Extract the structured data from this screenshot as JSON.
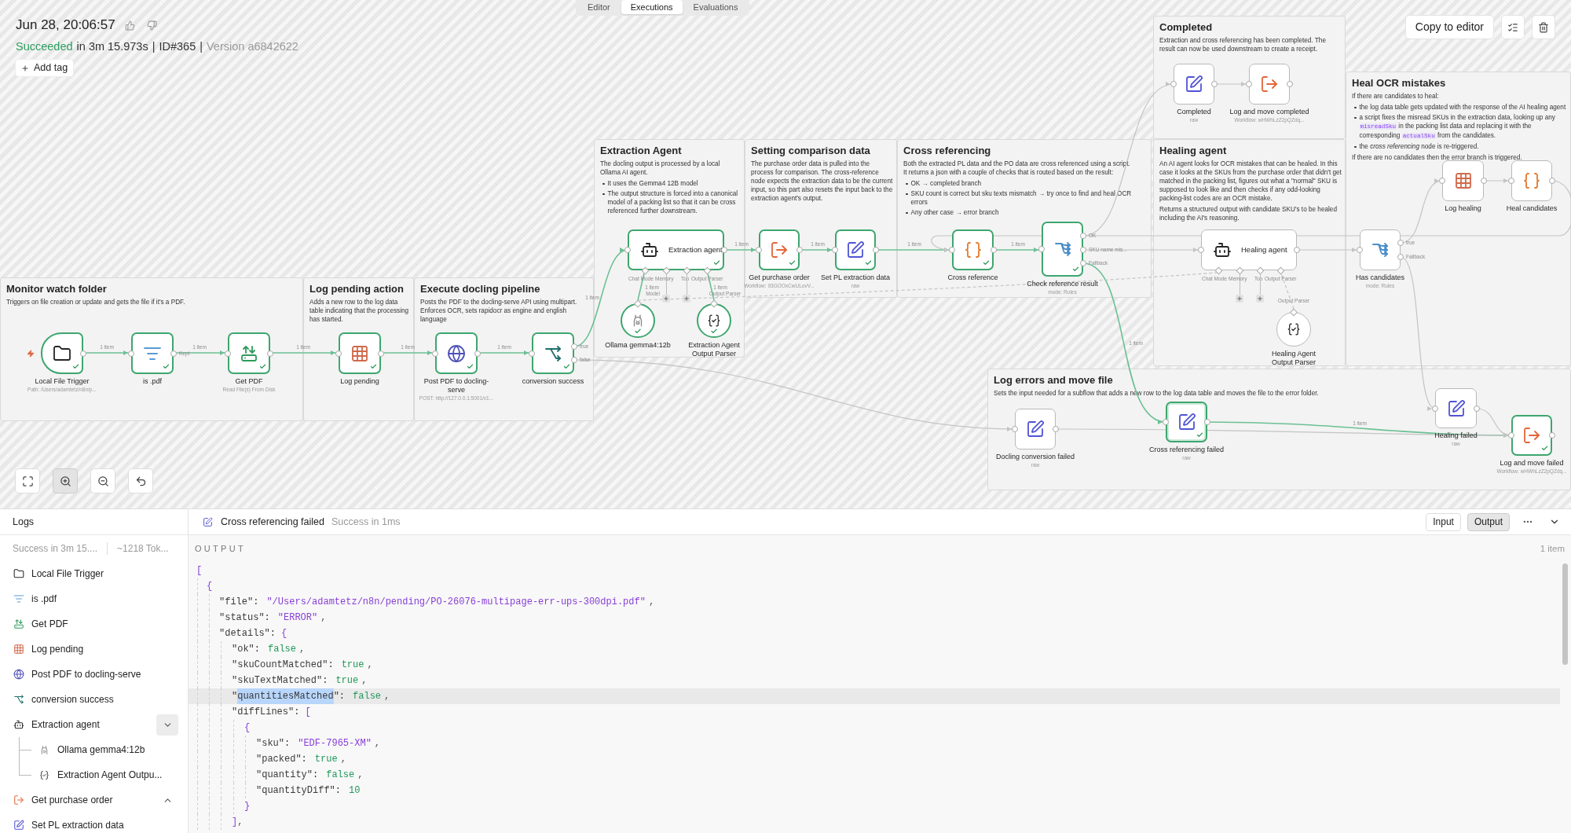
{
  "header": {
    "timestamp": "Jun 28, 20:06:57",
    "summary": [
      {
        "kind": "status",
        "text": "Succeeded"
      },
      {
        "kind": "plain",
        "text": "in 3m 15.973s"
      },
      {
        "kind": "separator",
        "text": "|"
      },
      {
        "kind": "plain",
        "text": "ID#365"
      },
      {
        "kind": "separator",
        "text": "|"
      },
      {
        "kind": "muted",
        "text": "Version a6842622"
      }
    ],
    "add_tag": "Add tag"
  },
  "tabs": [
    {
      "label": "Editor",
      "selected": false
    },
    {
      "label": "Executions",
      "selected": true
    },
    {
      "label": "Evaluations",
      "selected": false
    }
  ],
  "actions": {
    "copy_to_editor": "Copy to editor"
  },
  "canvas_controls": [
    {
      "kind": "fit",
      "active": false
    },
    {
      "kind": "zoom-in",
      "active": true
    },
    {
      "kind": "zoom-out",
      "active": false
    },
    {
      "kind": "reset",
      "active": false
    }
  ],
  "sticky_notes": [
    {
      "title": "Monitor watch folder",
      "blocks": [
        {
          "kind": "paragraph",
          "text": "Triggers on file creation or update and gets the file if it's a PDF."
        }
      ]
    },
    {
      "title": "Log pending action",
      "blocks": [
        {
          "kind": "paragraph",
          "text": "Adds a new row to the log data table indicating that the processing has started."
        }
      ]
    },
    {
      "title": "Execute docling pipeline",
      "blocks": [
        {
          "kind": "paragraph",
          "text": "Posts the PDF to the docling-serve API using multipart. Enforces OCR, sets rapidocr as engine and english language"
        }
      ]
    },
    {
      "title": "Extraction Agent",
      "blocks": [
        {
          "kind": "paragraph",
          "text": "The docling output is processed by a local Ollama AI agent."
        },
        {
          "kind": "list",
          "items": [
            "It uses the Gemma4 12B model",
            "The output structure is forced into a canonical model of a packing list so that it can be cross referenced further downstream."
          ]
        }
      ]
    },
    {
      "title": "Setting comparison data",
      "blocks": [
        {
          "kind": "paragraph",
          "text": "The purchase order data is pulled into the process for comparison. The cross-reference node expects the extraction data to be the current input, so this part also resets the input back to the extraction agent's output."
        }
      ]
    },
    {
      "title": "Cross referencing",
      "blocks": [
        {
          "kind": "paragraph",
          "text": "Both the extracted PL data and the PO data are cross referenced using a script.\nIt returns a json with a couple of checks that is routed based on the result:"
        },
        {
          "kind": "list",
          "items": [
            "OK → completed branch",
            "SKU count is correct but sku texts mismatch → try once to find and heal OCR errors",
            "Any other case → error branch"
          ]
        }
      ]
    },
    {
      "title": "Completed",
      "blocks": [
        {
          "kind": "paragraph",
          "text": "Extraction and cross referencing has been completed. The result can now be used downstream to create a receipt."
        }
      ]
    },
    {
      "title": "Healing agent",
      "blocks": [
        {
          "kind": "paragraph",
          "text": "An AI agent looks for OCR mistakes that can be healed. In this case it looks at the SKUs from the purchase order that didn't get matched in the packing list, figures out what a \"normal\" SKU is supposed to look like and then checks if any odd-looking packing-list codes are an OCR mistake."
        },
        {
          "kind": "paragraph",
          "text": "Returns a structured output with candidate SKU's to be healed including the AI's reasoning."
        }
      ]
    },
    {
      "title": "Heal OCR mistakes",
      "blocks": [
        {
          "kind": "paragraph",
          "text": "If there are candidates to heal:"
        },
        {
          "kind": "list",
          "items": [
            "the log data table gets updated with the response of the AI healing agent",
            {
              "segments": [
                {
                  "kind": "text",
                  "text": "a script fixes the misread SKUs in the extraction data, looking up any "
                },
                {
                  "kind": "code",
                  "text": "misreadSku"
                },
                {
                  "kind": "text",
                  "text": " in the packing list data and replacing it with the corresponding "
                },
                {
                  "kind": "code",
                  "text": "actualSku"
                },
                {
                  "kind": "text",
                  "text": " from the candidates."
                }
              ]
            },
            "the *cross referencing* node is re-triggered."
          ]
        },
        {
          "kind": "paragraph",
          "text": "If there are no candidates then the error branch is triggered."
        }
      ]
    },
    {
      "title": "Log errors and move file",
      "blocks": [
        {
          "kind": "paragraph",
          "text": "Sets the input needed for a subflow that adds a new row to the log data table and moves the file to the error folder."
        }
      ]
    }
  ],
  "nodes": [
    {
      "kind": "trigger",
      "label": "Local File Trigger",
      "subtitle": "Path: /Users/adamtetz/n8n/p...",
      "executed": true,
      "selected": false
    },
    {
      "kind": "filter",
      "label": "is .pdf",
      "outputs": [
        "Kept"
      ],
      "executed": true,
      "selected": false
    },
    {
      "kind": "read-file",
      "label": "Get PDF",
      "subtitle": "Read File(s) From Disk",
      "executed": true,
      "selected": false
    },
    {
      "kind": "data-table",
      "label": "Log pending",
      "executed": true,
      "selected": false
    },
    {
      "kind": "http",
      "label": "Post PDF to docling-serve",
      "subtitle": "POST: http://127.0.0.1:5001/v1...",
      "executed": true,
      "selected": false
    },
    {
      "kind": "if",
      "label": "conversion success",
      "outputs": [
        "true",
        "false"
      ],
      "executed": true,
      "selected": false
    },
    {
      "kind": "agent",
      "label": "Extraction agent",
      "ports": [
        "Chat Mode",
        "Memory",
        "Too",
        "Output Parser"
      ],
      "executed": true,
      "selected": false
    },
    {
      "kind": "model",
      "label": "Ollama gemma4:12b",
      "executed": true,
      "selected": false
    },
    {
      "kind": "parser",
      "label": "Extraction Agent Output Parser",
      "executed": true,
      "selected": false
    },
    {
      "kind": "execute-workflow",
      "label": "Get purchase order",
      "subtitle": "Workflow: 93GOOxCwULovV...",
      "executed": true,
      "selected": false
    },
    {
      "kind": "set",
      "label": "Set PL extraction data",
      "subtitle": "raw",
      "executed": true,
      "selected": false
    },
    {
      "kind": "code",
      "label": "Cross reference",
      "executed": true,
      "selected": false
    },
    {
      "kind": "switch",
      "label": "Check reference result",
      "subtitle": "mode: Rules",
      "outputs": [
        "OK",
        "SKU name mis...",
        "Fallback"
      ],
      "executed": true,
      "selected": false
    },
    {
      "kind": "set",
      "label": "Completed",
      "subtitle": "raw",
      "executed": false,
      "selected": false
    },
    {
      "kind": "execute-workflow",
      "label": "Log and move completed",
      "subtitle": "Workflow: wHWhLzZ2pQZdq...",
      "executed": false,
      "selected": false
    },
    {
      "kind": "agent",
      "label": "Healing agent",
      "ports": [
        "Chat Mode",
        "Memory",
        "Too",
        "Output Parser"
      ],
      "executed": false,
      "selected": false
    },
    {
      "kind": "parser",
      "label": "Healing Agent Output Parser",
      "executed": false,
      "selected": false
    },
    {
      "kind": "switch",
      "label": "Has candidates",
      "subtitle": "mode: Rules",
      "outputs": [
        "true",
        "Fallback"
      ],
      "executed": false,
      "selected": false
    },
    {
      "kind": "data-table",
      "label": "Log healing",
      "executed": false,
      "selected": false
    },
    {
      "kind": "code",
      "label": "Heal candidates",
      "executed": false,
      "selected": false
    },
    {
      "kind": "set",
      "label": "Docling conversion failed",
      "subtitle": "raw",
      "executed": false,
      "selected": false
    },
    {
      "kind": "set",
      "label": "Cross referencing failed",
      "subtitle": "raw",
      "executed": true,
      "selected": true
    },
    {
      "kind": "set",
      "label": "Healing failed",
      "subtitle": "raw",
      "executed": false,
      "selected": false
    },
    {
      "kind": "execute-workflow",
      "label": "Log and move failed",
      "subtitle": "Workflow: wHWhLzZ2pQZdq...",
      "executed": true,
      "selected": false
    }
  ],
  "connections": [
    {
      "label": "1 item",
      "executed": true
    },
    {
      "label": "1 item",
      "executed": true
    },
    {
      "label": "1 item",
      "executed": true
    },
    {
      "label": "1 item",
      "executed": true
    },
    {
      "label": "1 item",
      "executed": true
    },
    {
      "label": "1 item",
      "executed": true
    },
    {
      "executed": false
    },
    {
      "label": "1 item",
      "executed": true
    },
    {
      "label": "1 item",
      "executed": true
    },
    {
      "label": "1 item",
      "executed": true
    },
    {
      "label": "1 item",
      "executed": true
    },
    {
      "executed": false
    },
    {
      "executed": false
    },
    {
      "executed": false
    },
    {
      "label": "1 item",
      "executed": true
    },
    {
      "executed": false
    },
    {
      "executed": false
    },
    {
      "executed": false
    },
    {
      "executed": false
    },
    {
      "executed": false
    },
    {
      "executed": false
    },
    {
      "label": "1 item",
      "executed": true
    },
    {
      "executed": false
    },
    {
      "label": "1 item",
      "port_label": "Model",
      "executed": true
    },
    {
      "label": "1 item",
      "port_label": "Output Parser",
      "executed": true
    },
    {
      "port_label": "Output Parser",
      "executed": false
    },
    {
      "executed": false
    }
  ],
  "logs": {
    "title": "Logs",
    "summary": [
      "Success in 3m 15....",
      "~1218 Tok..."
    ],
    "items": [
      {
        "kind": "trigger",
        "label": "Local File Trigger"
      },
      {
        "kind": "filter",
        "label": "is .pdf"
      },
      {
        "kind": "read-file",
        "label": "Get PDF"
      },
      {
        "kind": "data-table",
        "label": "Log pending"
      },
      {
        "kind": "http",
        "label": "Post PDF to docling-serve"
      },
      {
        "kind": "if",
        "label": "conversion success"
      },
      {
        "kind": "agent",
        "label": "Extraction agent",
        "expanded": true,
        "children": [
          {
            "kind": "model",
            "label": "Ollama gemma4:12b"
          },
          {
            "kind": "parser",
            "label": "Extraction Agent Outpu..."
          }
        ]
      },
      {
        "kind": "execute-workflow",
        "label": "Get purchase order",
        "expanded": false
      },
      {
        "kind": "set",
        "label": "Set PL extraction data"
      }
    ]
  },
  "details": {
    "kind": "set",
    "title": "Cross referencing failed",
    "status": "Success in 1ms",
    "views": [
      {
        "label": "Input",
        "selected": false
      },
      {
        "label": "Output",
        "selected": true
      }
    ],
    "section": "OUTPUT",
    "count": "1 item",
    "lines": [
      {
        "tokens": [
          {
            "kind": "bracket",
            "text": "["
          }
        ],
        "highlighted": false,
        "children": [
          {
            "tokens": [
              {
                "kind": "bracket",
                "text": "{"
              }
            ],
            "highlighted": false,
            "children": [
              {
                "tokens": [
                  {
                    "kind": "key",
                    "text": "\"file\":"
                  },
                  {
                    "kind": "string",
                    "text": "\"/Users/adamtetz/n8n/pending/PO-26076-multipage-err-ups-300dpi.pdf\""
                  },
                  {
                    "kind": "punct",
                    "text": ","
                  }
                ],
                "highlighted": false
              },
              {
                "tokens": [
                  {
                    "kind": "key",
                    "text": "\"status\":"
                  },
                  {
                    "kind": "string",
                    "text": "\"ERROR\""
                  },
                  {
                    "kind": "punct",
                    "text": ","
                  }
                ],
                "highlighted": false
              },
              {
                "tokens": [
                  {
                    "kind": "key",
                    "text": "\"details\":"
                  },
                  {
                    "kind": "bracket",
                    "text": "{"
                  }
                ],
                "highlighted": false,
                "children": [
                  {
                    "tokens": [
                      {
                        "kind": "key",
                        "text": "\"ok\":"
                      },
                      {
                        "kind": "literal",
                        "text": "false"
                      },
                      {
                        "kind": "punct",
                        "text": ","
                      }
                    ],
                    "highlighted": false
                  },
                  {
                    "tokens": [
                      {
                        "kind": "key",
                        "text": "\"skuCountMatched\":"
                      },
                      {
                        "kind": "literal",
                        "text": "true"
                      },
                      {
                        "kind": "punct",
                        "text": ","
                      }
                    ],
                    "highlighted": false
                  },
                  {
                    "tokens": [
                      {
                        "kind": "key",
                        "text": "\"skuTextMatched\":"
                      },
                      {
                        "kind": "literal",
                        "text": "true"
                      },
                      {
                        "kind": "punct",
                        "text": ","
                      }
                    ],
                    "highlighted": false
                  },
                  {
                    "tokens": [
                      {
                        "kind": "key",
                        "text": "\""
                      },
                      {
                        "kind": "selection",
                        "text": "quantitiesMatched"
                      },
                      {
                        "kind": "key",
                        "text": "\":"
                      },
                      {
                        "kind": "literal",
                        "text": "false"
                      },
                      {
                        "kind": "punct",
                        "text": ","
                      }
                    ],
                    "highlighted": true
                  },
                  {
                    "tokens": [
                      {
                        "kind": "key",
                        "text": "\"diffLines\":"
                      },
                      {
                        "kind": "bracket",
                        "text": "["
                      }
                    ],
                    "highlighted": false,
                    "children": [
                      {
                        "tokens": [
                          {
                            "kind": "bracket",
                            "text": "{"
                          }
                        ],
                        "highlighted": false,
                        "children": [
                          {
                            "tokens": [
                              {
                                "kind": "key",
                                "text": "\"sku\":"
                              },
                              {
                                "kind": "string",
                                "text": "\"EDF-7965-XM\""
                              },
                              {
                                "kind": "punct",
                                "text": ","
                              }
                            ],
                            "highlighted": false
                          },
                          {
                            "tokens": [
                              {
                                "kind": "key",
                                "text": "\"packed\":"
                              },
                              {
                                "kind": "literal",
                                "text": "true"
                              },
                              {
                                "kind": "punct",
                                "text": ","
                              }
                            ],
                            "highlighted": false
                          },
                          {
                            "tokens": [
                              {
                                "kind": "key",
                                "text": "\"quantity\":"
                              },
                              {
                                "kind": "literal",
                                "text": "false"
                              },
                              {
                                "kind": "punct",
                                "text": ","
                              }
                            ],
                            "highlighted": false
                          },
                          {
                            "tokens": [
                              {
                                "kind": "key",
                                "text": "\"quantityDiff\":"
                              },
                              {
                                "kind": "literal",
                                "text": "10"
                              }
                            ],
                            "highlighted": false
                          }
                        ]
                      },
                      {
                        "tokens": [
                          {
                            "kind": "bracket",
                            "text": "}"
                          }
                        ],
                        "highlighted": false
                      }
                    ]
                  },
                  {
                    "tokens": [
                      {
                        "kind": "bracket",
                        "text": "]"
                      },
                      {
                        "kind": "punct",
                        "text": ","
                      }
                    ],
                    "highlighted": false
                  }
                ]
              }
            ]
          }
        ]
      }
    ]
  }
}
